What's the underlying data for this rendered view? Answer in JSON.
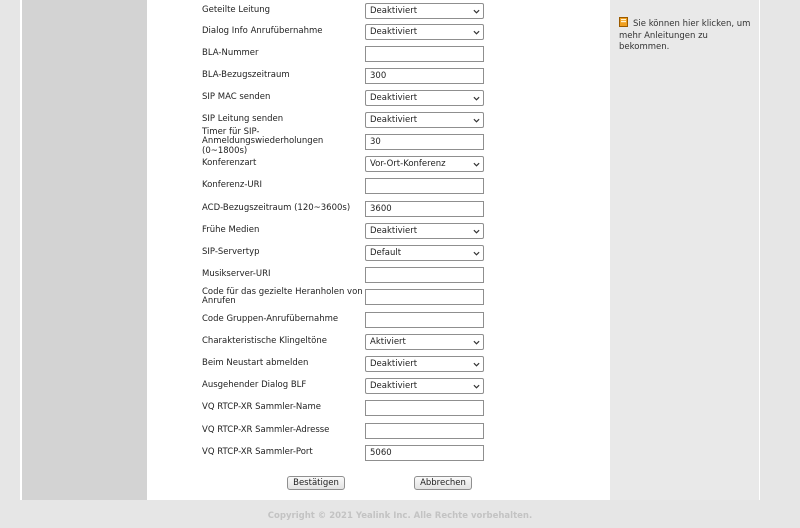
{
  "rows": [
    {
      "label": "Geteilte Leitung",
      "type": "select",
      "value": "Deaktiviert"
    },
    {
      "label": "Dialog Info Anrufübernahme",
      "type": "select",
      "value": "Deaktiviert"
    },
    {
      "label": "BLA-Nummer",
      "type": "input",
      "value": ""
    },
    {
      "label": "BLA-Bezugszeitraum",
      "type": "input",
      "value": "300"
    },
    {
      "label": "SIP MAC senden",
      "type": "select",
      "value": "Deaktiviert"
    },
    {
      "label": "SIP Leitung senden",
      "type": "select",
      "value": "Deaktiviert"
    },
    {
      "label": "Timer für SIP-Anmeldungswiederholungen (0~1800s)",
      "type": "input",
      "value": "30"
    },
    {
      "label": "Konferenzart",
      "type": "select",
      "value": "Vor-Ort-Konferenz"
    },
    {
      "label": "Konferenz-URI",
      "type": "input",
      "value": ""
    },
    {
      "label": "ACD-Bezugszeitraum (120~3600s)",
      "type": "input",
      "value": "3600"
    },
    {
      "label": "Frühe Medien",
      "type": "select",
      "value": "Deaktiviert"
    },
    {
      "label": "SIP-Servertyp",
      "type": "select",
      "value": "Default"
    },
    {
      "label": "Musikserver-URI",
      "type": "input",
      "value": ""
    },
    {
      "label": "Code für das gezielte Heranholen von Anrufen",
      "type": "input",
      "value": ""
    },
    {
      "label": "Code Gruppen-Anrufübernahme",
      "type": "input",
      "value": ""
    },
    {
      "label": "Charakteristische Klingeltöne",
      "type": "select",
      "value": "Aktiviert"
    },
    {
      "label": "Beim Neustart abmelden",
      "type": "select",
      "value": "Deaktiviert"
    },
    {
      "label": "Ausgehender Dialog BLF",
      "type": "select",
      "value": "Deaktiviert"
    },
    {
      "label": "VQ RTCP-XR Sammler-Name",
      "type": "input",
      "value": ""
    },
    {
      "label": "VQ RTCP-XR Sammler-Adresse",
      "type": "input",
      "value": ""
    },
    {
      "label": "VQ RTCP-XR Sammler-Port",
      "type": "input",
      "value": "5060"
    }
  ],
  "help": {
    "text": "Sie können hier klicken, um mehr Anleitungen zu bekommen.",
    "icon": "book-icon"
  },
  "buttons": {
    "confirm": "Bestätigen",
    "cancel": "Abbrechen"
  },
  "footer": "Copyright © 2021 Yealink Inc. Alle Rechte vorbehalten.",
  "colors": {
    "page_bg": "#e6e6e6",
    "left_column": "#d3d3d3",
    "right_column": "#e9e9e9",
    "footer_text": "#c3c3c3",
    "help_icon": "#f0a020"
  }
}
